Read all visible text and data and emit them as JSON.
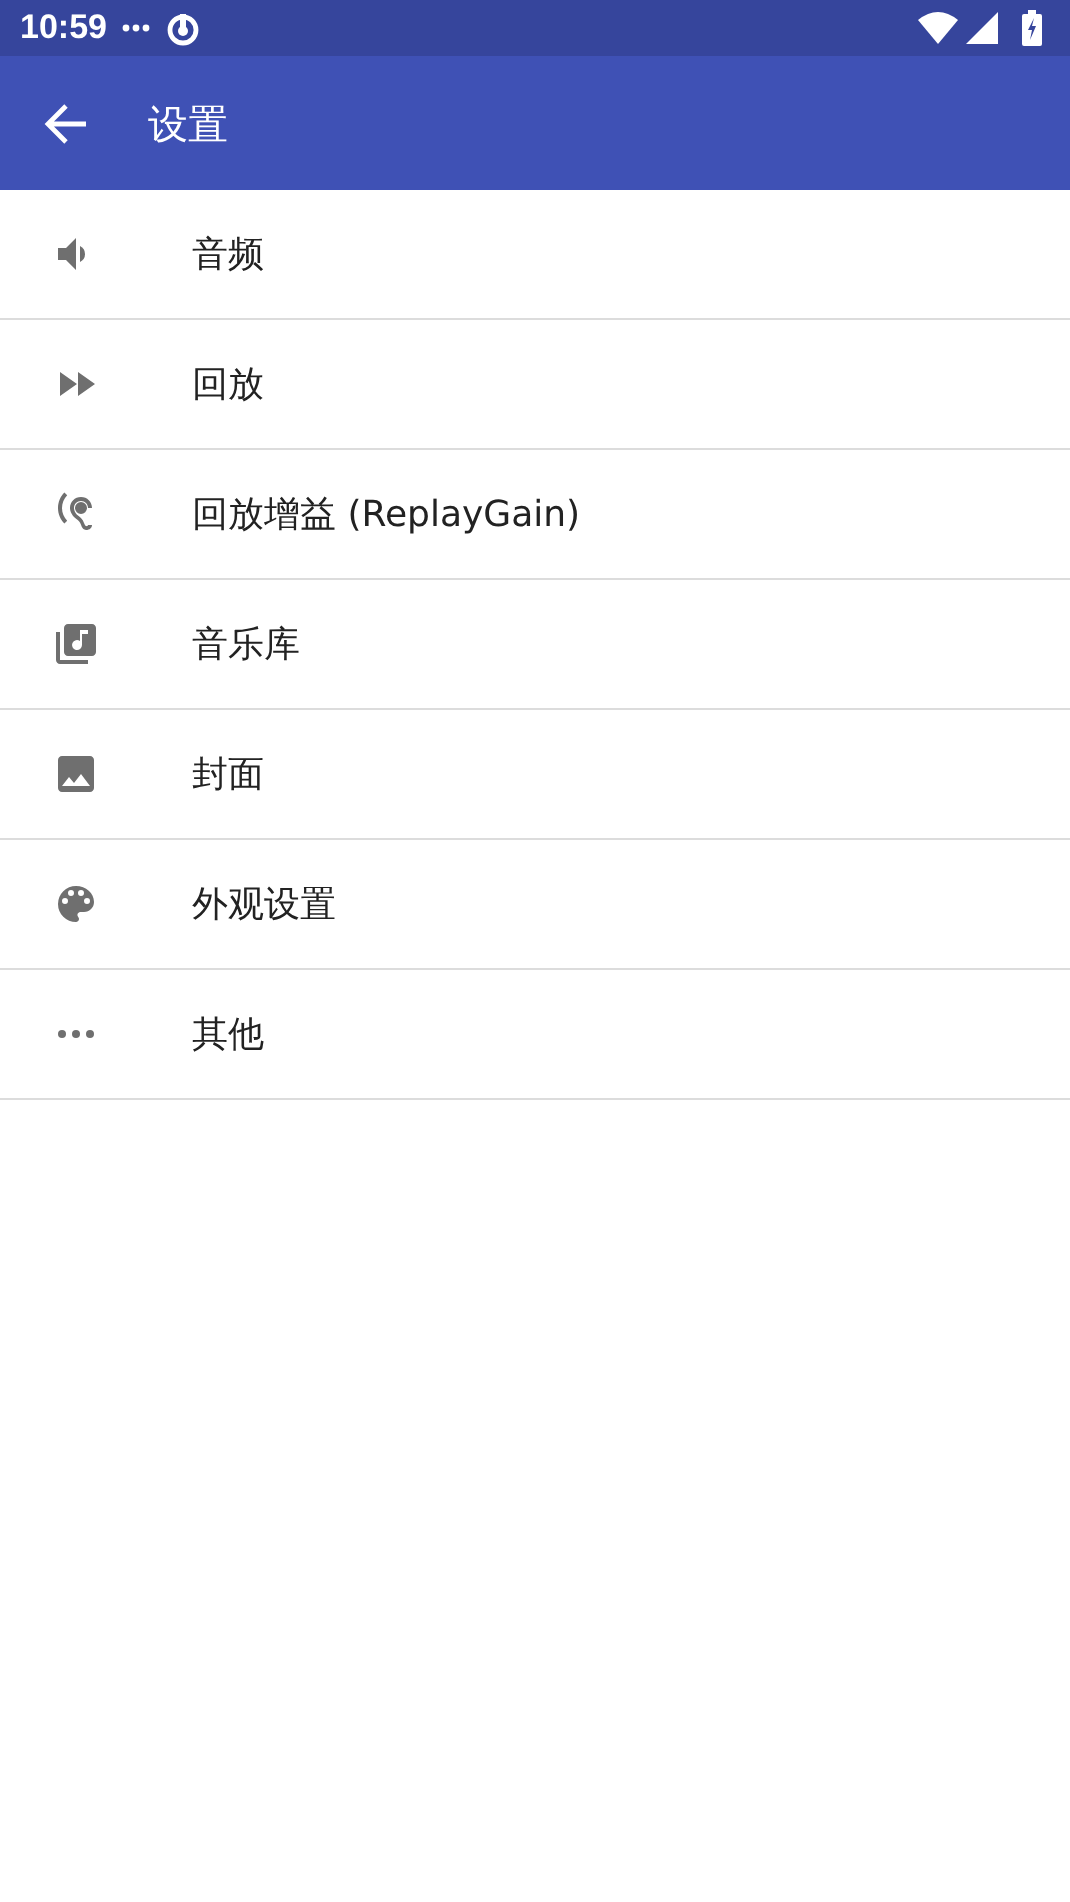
{
  "status_bar": {
    "time": "10:59"
  },
  "app_bar": {
    "title": "设置"
  },
  "settings": [
    {
      "label": "音频"
    },
    {
      "label": "回放"
    },
    {
      "label": "回放增益 (ReplayGain)"
    },
    {
      "label": "音乐库"
    },
    {
      "label": "封面"
    },
    {
      "label": "外观设置"
    },
    {
      "label": "其他"
    }
  ]
}
